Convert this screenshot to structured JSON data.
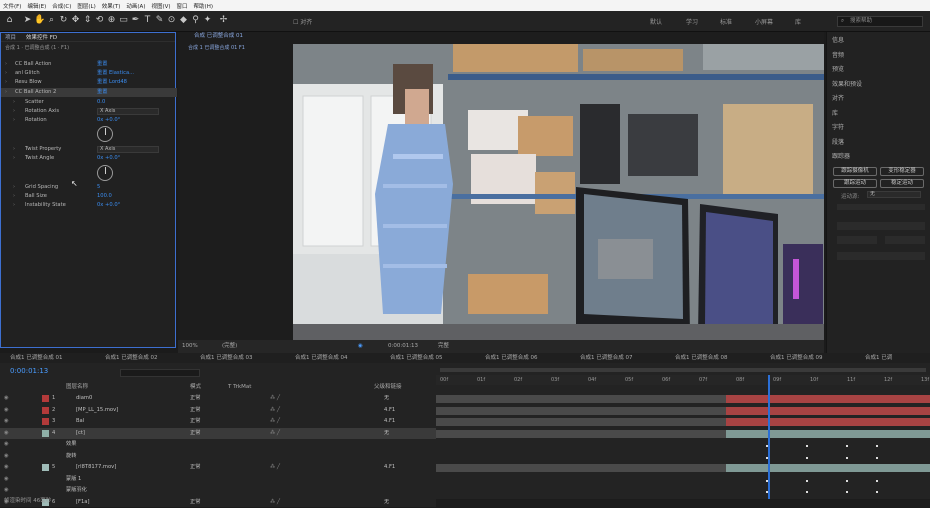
{
  "menu": [
    "文件(F)",
    "编辑(E)",
    "合成(C)",
    "图层(L)",
    "效果(T)",
    "动画(A)",
    "视图(V)",
    "窗口",
    "帮助(H)"
  ],
  "toolbar": {
    "snapping_label": "对齐",
    "workspaces": [
      "默认",
      "学习",
      "标准",
      "小屏幕",
      "库"
    ],
    "search_placeholder": "搜索帮助"
  },
  "left_panel": {
    "tabs": [
      "项目",
      "效果控件 FD"
    ],
    "header": "合成 1 · 已调整合成 (1 · F1)",
    "rows": [
      {
        "label": "CC Ball Action",
        "value": "重置",
        "indent": 0
      },
      {
        "label": "anl Glitch",
        "value": "重置  Elastica...",
        "indent": 0
      },
      {
        "label": "Resu Blow",
        "value": "重置  Lord48",
        "indent": 0
      },
      {
        "label": "CC Ball Action 2",
        "value": "重置",
        "indent": 0,
        "selected": true
      },
      {
        "label": "Scatter",
        "value": "0.0",
        "indent": 1
      },
      {
        "label": "Rotation Axis",
        "value": "X Axis",
        "indent": 1,
        "dropdown": true
      },
      {
        "label": "Rotation",
        "value": "0x +0.0°",
        "indent": 1
      },
      {
        "label": "Twist Property",
        "value": "X Axis",
        "indent": 1,
        "dropdown": true
      },
      {
        "label": "Twist Angle",
        "value": "0x +0.0°",
        "indent": 1
      },
      {
        "label": "Grid Spacing",
        "value": "5",
        "indent": 1
      },
      {
        "label": "Ball Size",
        "value": "100.0",
        "indent": 1
      },
      {
        "label": "Instability State",
        "value": "0x +0.0°",
        "indent": 1
      }
    ]
  },
  "viewer": {
    "tab_label": "合成 已调整合成 01",
    "breadcrumb": "合成 1 已调整合成 01   F1",
    "zoom": "(完整)",
    "timecode": "0:00:01:13",
    "resolution": "完整"
  },
  "right_panel": {
    "items": [
      "信息",
      "音频",
      "预览",
      "效果和预设",
      "对齐",
      "库",
      "字符",
      "段落",
      "跟踪器"
    ],
    "tracker_buttons": [
      "跟踪摄像机",
      "变形稳定器",
      "跟踪运动",
      "稳定运动"
    ],
    "motion_source_label": "运动源:",
    "motion_source_value": "无"
  },
  "timeline": {
    "comp_tabs": [
      "合成1 已调整合成 01",
      "合成1 已调整合成 02",
      "合成1 已调整合成 03",
      "合成1 已调整合成 04",
      "合成1 已调整合成 05",
      "合成1 已调整合成 06",
      "合成1 已调整合成 07",
      "合成1 已调整合成 08",
      "合成1 已调整合成 09",
      "合成1 已调"
    ],
    "timecode": "0:00:01:13",
    "columns": [
      "图层名称",
      "模式",
      "T TrkMat",
      "父级和链接"
    ],
    "layers": [
      {
        "num": "1",
        "name": "diam0",
        "color": "#b33a3a",
        "mode": "正常",
        "parent": "无"
      },
      {
        "num": "2",
        "name": "[MP_LL_15.mov]",
        "color": "#b33a3a",
        "mode": "正常",
        "parent": "4.F1"
      },
      {
        "num": "3",
        "name": "Bal",
        "color": "#b33a3a",
        "mode": "正常",
        "parent": "4.F1"
      },
      {
        "num": "4",
        "name": "[ct]",
        "color": "#8fb0a8",
        "mode": "正常",
        "parent": "无",
        "selected": true
      },
      {
        "num": "",
        "name": "效果",
        "color": "",
        "mode": "",
        "parent": ""
      },
      {
        "num": "",
        "name": "旋转",
        "color": "",
        "mode": "",
        "parent": ""
      },
      {
        "num": "5",
        "name": "[rl8T8177.mov]",
        "color": "#9fbcb8",
        "mode": "正常",
        "parent": "4.F1"
      },
      {
        "num": "",
        "name": "蒙版 1",
        "color": "",
        "mode": "",
        "parent": ""
      },
      {
        "num": "",
        "name": "蒙版羽化",
        "color": "",
        "mode": "",
        "parent": ""
      },
      {
        "num": "6",
        "name": "[F1a]",
        "color": "#9fbcb8",
        "mode": "正常",
        "parent": "无"
      }
    ],
    "ruler_labels": [
      "00f",
      "01f",
      "02f",
      "03f",
      "04f",
      "05f",
      "06f",
      "07f",
      "08f",
      "09f",
      "10f",
      "11f",
      "12f",
      "13f"
    ],
    "status": "帧渲染时间 46毫秒"
  },
  "colors": {
    "accent": "#3b8df0",
    "selection": "#3d6fd0",
    "layer_red": "#b33a3a",
    "layer_teal": "#8fb0a8"
  }
}
